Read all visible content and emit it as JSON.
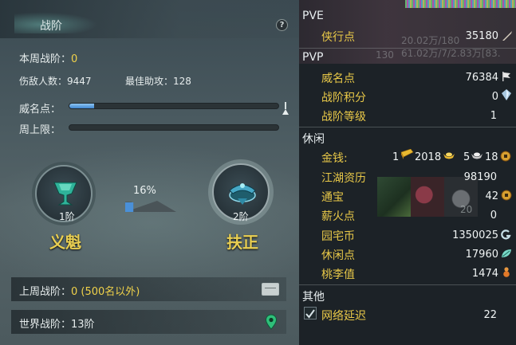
{
  "left_panel": {
    "title": "战阶",
    "help_glyph": "?",
    "weekly_rank_label": "本周战阶：",
    "weekly_rank_value": "0",
    "kills_label": "伤敌人数：9447",
    "best_assist_label": "最佳助攻：128",
    "prestige_label": "威名点：",
    "prestige_progress": 0.12,
    "weekly_cap_label": "周上限：",
    "weekly_cap_progress": 0.0,
    "emblem_left": {
      "level": "1阶",
      "name": "义魁"
    },
    "emblem_right": {
      "level": "2阶",
      "name": "扶正"
    },
    "upgrade_percent": "16%",
    "upgrade_progress": 0.16,
    "last_week_label": "上周战阶：",
    "last_week_value": "0 (500名以外)",
    "world_rank_label": "世界战阶：13阶"
  },
  "right_panel": {
    "faint_top_1": "20.02万/180",
    "faint_top_2": "61.02万/7/2.83万[83.",
    "faint_130": "130",
    "faint_20": "20",
    "pve": {
      "title": "PVE",
      "items": [
        {
          "label": "侠行点",
          "value": "35180",
          "icon": "sword-icon"
        }
      ]
    },
    "pvp": {
      "title": "PVP",
      "items": [
        {
          "label": "威名点",
          "value": "76384",
          "icon": "flag-icon"
        },
        {
          "label": "战阶积分",
          "value": "0",
          "icon": "crystal-icon"
        },
        {
          "label": "战阶等级",
          "value": "1"
        }
      ]
    },
    "leisure": {
      "title": "休闲",
      "money_label": "金钱:",
      "money": [
        {
          "amount": "1",
          "icon": "gold-bar-icon"
        },
        {
          "amount": "2018",
          "icon": "gold-ingot-icon"
        },
        {
          "amount": "5",
          "icon": "silver-ingot-icon"
        },
        {
          "amount": "18",
          "icon": "copper-coin-icon"
        }
      ],
      "items": [
        {
          "label": "江湖资历",
          "value": "98190"
        },
        {
          "label": "通宝",
          "value": "42",
          "icon": "coin-icon"
        },
        {
          "label": "薪火点",
          "value": "0"
        },
        {
          "label": "园宅币",
          "value": "1350025",
          "icon": "g-coin-icon"
        },
        {
          "label": "休闲点",
          "value": "17960",
          "icon": "leaf-icon"
        },
        {
          "label": "桃李值",
          "value": "1474",
          "icon": "gourd-icon"
        }
      ]
    },
    "other": {
      "title": "其他",
      "items": [
        {
          "label": "网络延迟",
          "value": "22",
          "checked": true
        }
      ]
    },
    "colors": {
      "gold_label": "#e8c848",
      "yellow_value": "#f0d24a",
      "bar_blue": "#3f86d0"
    }
  }
}
